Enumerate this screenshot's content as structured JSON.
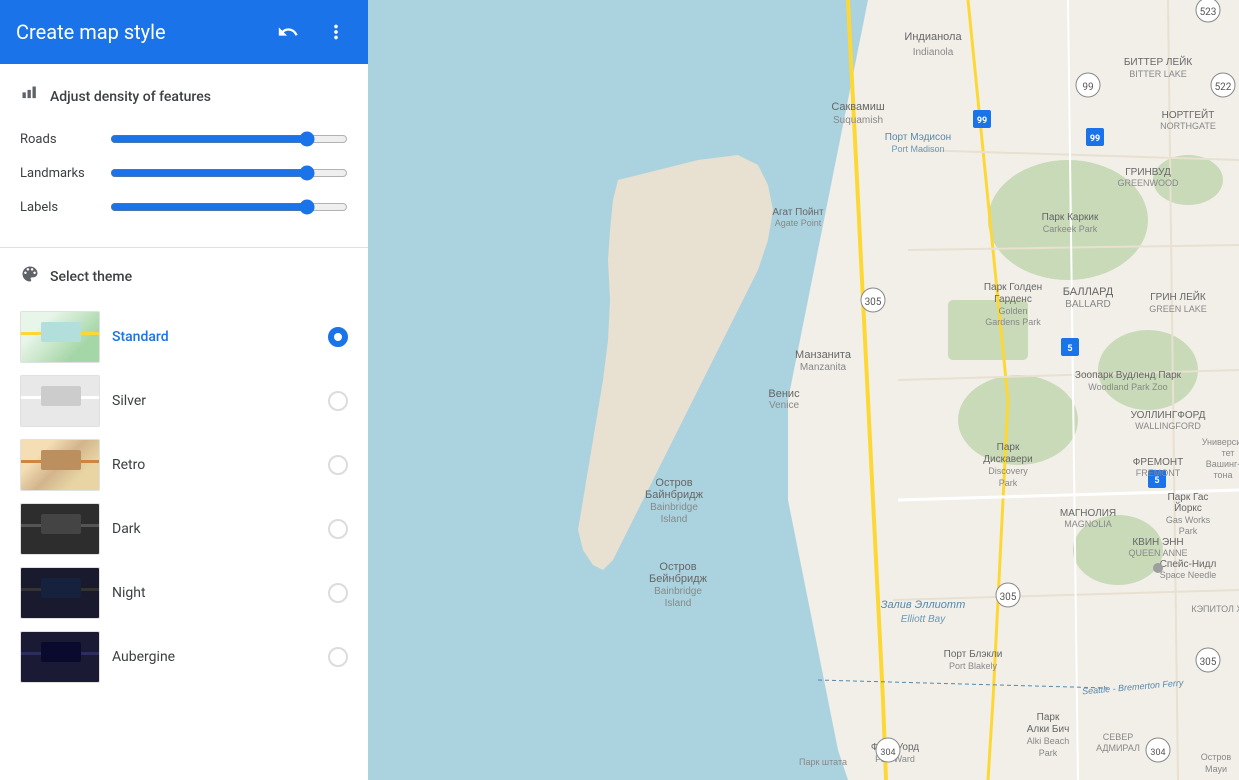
{
  "header": {
    "title": "Create map style",
    "undo_label": "undo",
    "menu_label": "more options"
  },
  "density": {
    "section_title": "Adjust density of features",
    "sliders": [
      {
        "label": "Roads",
        "value": 85
      },
      {
        "label": "Landmarks",
        "value": 85
      },
      {
        "label": "Labels",
        "value": 85
      }
    ]
  },
  "themes": {
    "section_title": "Select theme",
    "items": [
      {
        "id": "standard",
        "name": "Standard",
        "selected": true,
        "thumb_class": "thumb-standard"
      },
      {
        "id": "silver",
        "name": "Silver",
        "selected": false,
        "thumb_class": "thumb-silver"
      },
      {
        "id": "retro",
        "name": "Retro",
        "selected": false,
        "thumb_class": "thumb-retro"
      },
      {
        "id": "dark",
        "name": "Dark",
        "selected": false,
        "thumb_class": "thumb-dark"
      },
      {
        "id": "night",
        "name": "Night",
        "selected": false,
        "thumb_class": "thumb-night"
      },
      {
        "id": "aubergine",
        "name": "Aubergine",
        "selected": false,
        "thumb_class": "thumb-aubergine"
      }
    ]
  },
  "colors": {
    "accent": "#1a73e8",
    "water": "#aad3df",
    "land": "#f2efe9",
    "green": "#c8dab8",
    "road": "#fdd835",
    "text": "#3c4043"
  }
}
